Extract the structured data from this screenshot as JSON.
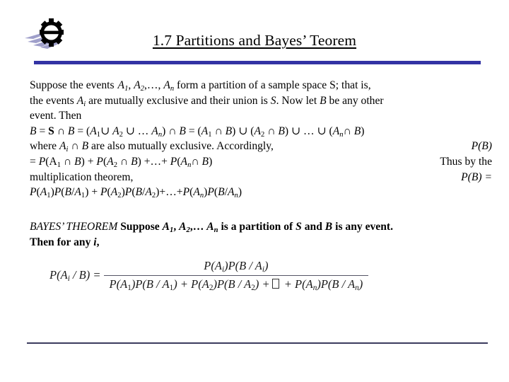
{
  "slide": {
    "logo_name": "gear-logo",
    "title": "1.7 Partitions and Bayes’ Teorem",
    "accent_top_color": "#3333a4",
    "accent_bottom_color": "#3b3b5e"
  },
  "body": {
    "line1_a": "Suppose the events",
    "line1_A1": "A",
    "line1_A1_sub": "1",
    "line1_comma1": ",",
    "line1_A2": "A",
    "line1_A2_sub": "2",
    "line1_dots": ",…,",
    "line1_An": "A",
    "line1_An_sub": "n",
    "line1_b": "form a partition of a sample space S; that is,",
    "line2_a": "the events",
    "line2_Ai": "A",
    "line2_Ai_sub": "i",
    "line2_b": "are mutually exclusive and their union is",
    "line2_S": "S",
    "line2_c": ". Now let",
    "line2_B": "B",
    "line2_d": "be any other",
    "line3": "event. Then",
    "eq_line": "B = S ∩ B = (A1∪ A2 ∪ … An) ∩ B = (A1 ∩ B) ∪ (A2 ∩ B) ∪ … ∪ (An∩ B)",
    "line5_left": "where Ai ∩ B are also mutually exclusive. Accordingly,",
    "line5_right": "P(B)",
    "line6_left": "= P(A1 ∩ B) + P(A2 ∩ B) +…+ P(An∩ B)",
    "line6_right": "Thus by the",
    "line7_left": "multiplication theorem,",
    "line7_right": "P(B) =",
    "line8": "P(A1)P(B/A1) + P(A2)P(B/A2)+…+P(An)P(B/An)"
  },
  "bayes": {
    "label": "BAYES’ THEOREM",
    "text_a": "Suppose",
    "A1": "A",
    "A1_sub": "1",
    "A2": "A",
    "A2_sub": "2",
    "dots": ",…",
    "An": "A",
    "An_sub": "n",
    "text_b": "is a partition of",
    "S": "S",
    "text_c": "and",
    "B": "B",
    "text_d": "is any event.",
    "text_e": "Then for any",
    "i": "i",
    "text_f": ","
  },
  "formula": {
    "lhs": "P(Ai / B) =",
    "numerator": "P(Ai)P(B / Ai)",
    "denominator": "P(A1)P(B / A1) + P(A2)P(B / A2) +□  + P(An)P(B / An)"
  }
}
